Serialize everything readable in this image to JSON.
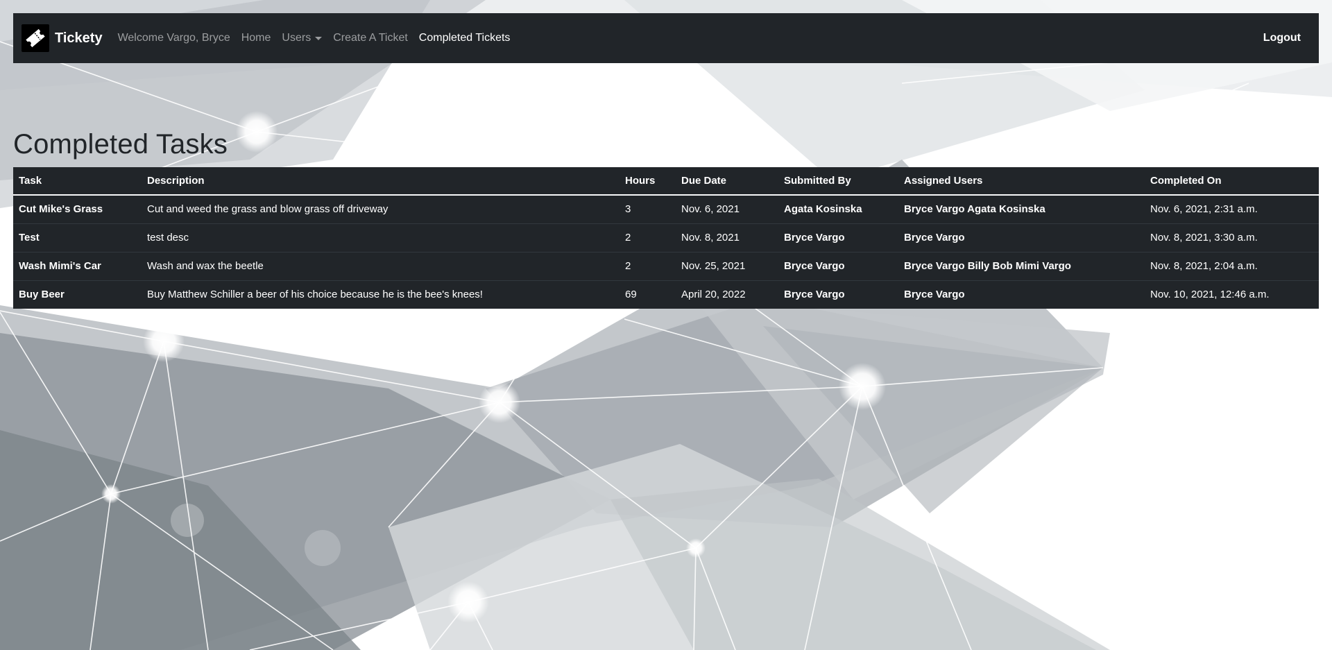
{
  "navbar": {
    "brand": "Tickety",
    "welcome": "Welcome Vargo, Bryce",
    "home": "Home",
    "users": "Users",
    "create_ticket": "Create A Ticket",
    "completed_tickets": "Completed Tickets",
    "logout": "Logout"
  },
  "page": {
    "title": "Completed Tasks"
  },
  "table": {
    "headers": {
      "task": "Task",
      "description": "Description",
      "hours": "Hours",
      "due_date": "Due Date",
      "submitted_by": "Submitted By",
      "assigned_users": "Assigned Users",
      "completed_on": "Completed On"
    },
    "rows": [
      {
        "task": "Cut Mike's Grass",
        "description": "Cut and weed the grass and blow grass off driveway",
        "hours": "3",
        "due_date": "Nov. 6, 2021",
        "submitted_by": "Agata Kosinska",
        "assigned_users": "Bryce Vargo Agata Kosinska",
        "completed_on": "Nov. 6, 2021, 2:31 a.m."
      },
      {
        "task": "Test",
        "description": "test desc",
        "hours": "2",
        "due_date": "Nov. 8, 2021",
        "submitted_by": "Bryce Vargo",
        "assigned_users": "Bryce Vargo",
        "completed_on": "Nov. 8, 2021, 3:30 a.m."
      },
      {
        "task": "Wash Mimi's Car",
        "description": "Wash and wax the beetle",
        "hours": "2",
        "due_date": "Nov. 25, 2021",
        "submitted_by": "Bryce Vargo",
        "assigned_users": "Bryce Vargo Billy Bob Mimi Vargo",
        "completed_on": "Nov. 8, 2021, 2:04 a.m."
      },
      {
        "task": "Buy Beer",
        "description": "Buy Matthew Schiller a beer of his choice because he is the bee's knees!",
        "hours": "69",
        "due_date": "April 20, 2022",
        "submitted_by": "Bryce Vargo",
        "assigned_users": "Bryce Vargo",
        "completed_on": "Nov. 10, 2021, 12:46 a.m."
      }
    ]
  },
  "colors": {
    "navbar_bg": "#212529",
    "table_bg": "#212529",
    "nav_muted": "rgba(255,255,255,0.55)",
    "text_light": "#ffffff"
  },
  "icons": {
    "brand": "ticket-icon",
    "users_dropdown": "caret-down-icon"
  }
}
